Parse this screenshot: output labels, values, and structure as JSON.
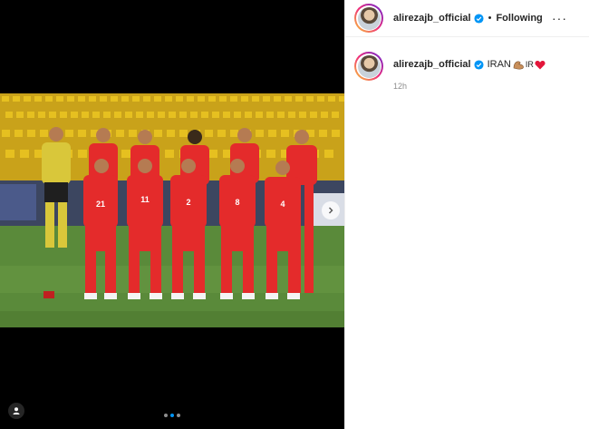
{
  "post": {
    "username": "alirezajb_official",
    "follow_state": "Following",
    "bullet": "•",
    "more": "···",
    "caption_text": "IRAN",
    "caption_emoji_text": "IR",
    "timestamp": "12h",
    "jersey_numbers": [
      "21",
      "11",
      "2",
      "8",
      "4"
    ],
    "carousel": {
      "slide_count": 3,
      "active_index": 1
    }
  },
  "colors": {
    "kit_red": "#e42b2b",
    "keeper_yellow": "#d9c73a",
    "pitch_green": "#5a8a3a",
    "stand_yellow": "#e6c020",
    "verified_blue": "#0095f6"
  },
  "icons": {
    "next": "chevron-right-icon",
    "tag": "user-tag-icon",
    "more": "more-options-icon",
    "verified": "verified-badge-icon"
  }
}
